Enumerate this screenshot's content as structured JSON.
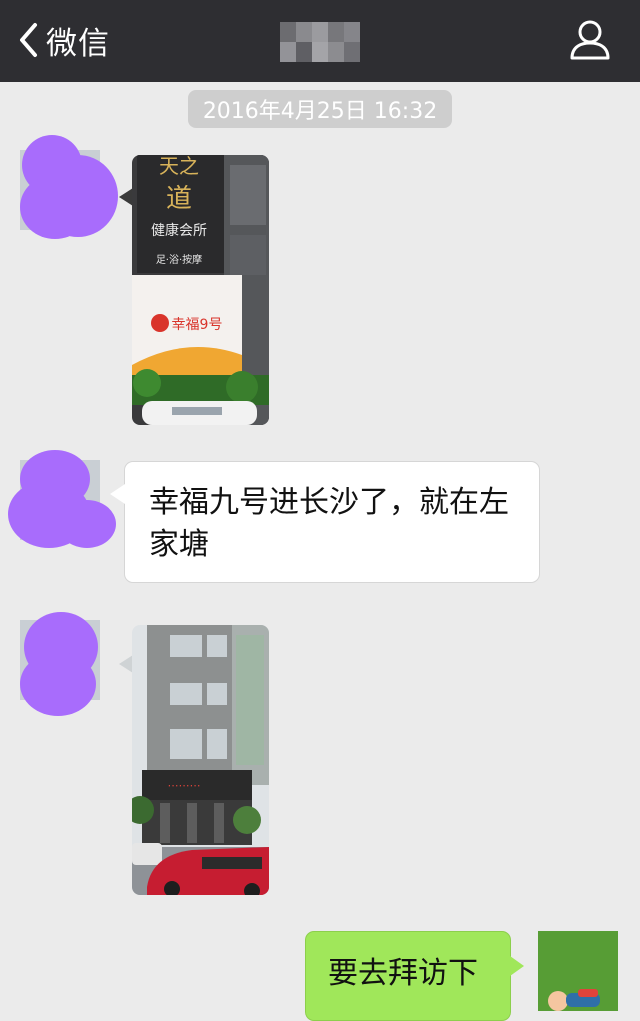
{
  "header": {
    "back_label": "微信",
    "back_icon": "chevron-left-icon",
    "title_blurred": true,
    "profile_icon": "person-icon"
  },
  "messages": {
    "timestamp": "2016年4月25日 16:32",
    "text_in": "幸福九号进长沙了，就在左家塘",
    "text_out": "要去拜访下",
    "image_1_sign_text": "幸福9号",
    "image_1_building_sign": "健康会所",
    "image_1_sign_lines": "足·浴·按摩"
  },
  "colors": {
    "topbar": "#2e2e32",
    "background": "#ebebeb",
    "bubble_out": "#a0e75a",
    "avatar_mask": "#a86cfc"
  }
}
